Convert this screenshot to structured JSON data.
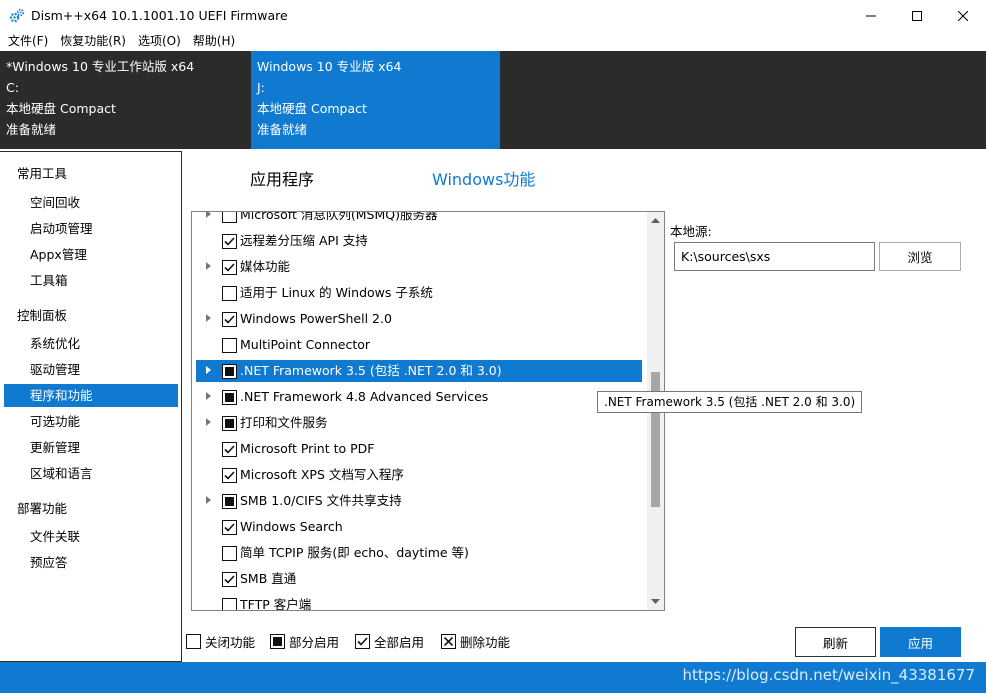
{
  "window": {
    "title": "Dism++x64 10.1.1001.10 UEFI Firmware",
    "minimize_glyph": "—",
    "maximize_glyph": "☐",
    "close_glyph": "✕"
  },
  "menu": [
    "文件(F)",
    "恢复功能(R)",
    "选项(O)",
    "帮助(H)"
  ],
  "images": [
    {
      "name": "*Windows 10 专业工作站版 x64",
      "drive": "C:",
      "type": "本地硬盘 Compact",
      "status": "准备就绪"
    },
    {
      "name": "Windows 10 专业版 x64",
      "drive": "J:",
      "type": "本地硬盘 Compact",
      "status": "准备就绪"
    }
  ],
  "sidebar": {
    "groups": [
      {
        "title": "常用工具",
        "items": [
          "空间回收",
          "启动项管理",
          "Appx管理",
          "工具箱"
        ]
      },
      {
        "title": "控制面板",
        "items": [
          "系统优化",
          "驱动管理",
          "程序和功能",
          "可选功能",
          "更新管理",
          "区域和语言"
        ]
      },
      {
        "title": "部署功能",
        "items": [
          "文件关联",
          "预应答"
        ]
      }
    ],
    "selected": "程序和功能"
  },
  "tabs": {
    "apps": "应用程序",
    "features": "Windows功能",
    "active": "Windows功能"
  },
  "features": [
    {
      "label": "Microsoft 消息队列(MSMQ)服务器",
      "state": "unchecked",
      "expandable": true
    },
    {
      "label": "远程差分压缩 API 支持",
      "state": "checked",
      "expandable": false
    },
    {
      "label": "媒体功能",
      "state": "checked",
      "expandable": true
    },
    {
      "label": "适用于 Linux 的 Windows 子系统",
      "state": "unchecked",
      "expandable": false
    },
    {
      "label": "Windows PowerShell 2.0",
      "state": "checked",
      "expandable": true
    },
    {
      "label": "MultiPoint Connector",
      "state": "unchecked",
      "expandable": false
    },
    {
      "label": ".NET Framework 3.5 (包括 .NET 2.0 和 3.0)",
      "state": "partial",
      "expandable": true,
      "selected": true
    },
    {
      "label": ".NET Framework 4.8 Advanced Services",
      "state": "partial",
      "expandable": true
    },
    {
      "label": "打印和文件服务",
      "state": "partial",
      "expandable": true
    },
    {
      "label": "Microsoft Print to PDF",
      "state": "checked",
      "expandable": false
    },
    {
      "label": "Microsoft XPS 文档写入程序",
      "state": "checked",
      "expandable": false
    },
    {
      "label": "SMB 1.0/CIFS 文件共享支持",
      "state": "partial",
      "expandable": true
    },
    {
      "label": "Windows Search",
      "state": "checked",
      "expandable": false
    },
    {
      "label": "简单 TCPIP 服务(即 echo、daytime 等)",
      "state": "unchecked",
      "expandable": false
    },
    {
      "label": "SMB 直通",
      "state": "checked",
      "expandable": false
    },
    {
      "label": "TFTP 客户端",
      "state": "unchecked",
      "expandable": false
    }
  ],
  "tooltip": ".NET Framework 3.5 (包括 .NET 2.0 和 3.0)",
  "source": {
    "label": "本地源:",
    "value": "K:\\sources\\sxs",
    "browse": "浏览"
  },
  "legend": [
    {
      "label": "关闭功能",
      "state": "unchecked"
    },
    {
      "label": "部分启用",
      "state": "partial"
    },
    {
      "label": "全部启用",
      "state": "checked"
    },
    {
      "label": "删除功能",
      "state": "removed"
    }
  ],
  "buttons": {
    "refresh": "刷新",
    "apply": "应用"
  },
  "watermark": "https://blog.csdn.net/weixin_43381677",
  "colors": {
    "accent": "#0f7ad0",
    "dark": "#2b2b2b"
  },
  "icons": {
    "app": "gears-icon"
  }
}
